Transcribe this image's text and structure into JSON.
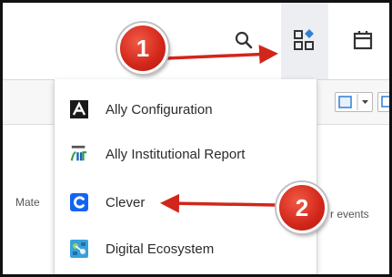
{
  "toolbar": {
    "icons": [
      "search-icon",
      "apps-grid-icon",
      "calendar-icon"
    ]
  },
  "background": {
    "left_text": "Mate",
    "right_text": "r events"
  },
  "app_menu": {
    "items": [
      {
        "label": "Ally Configuration",
        "icon": "ally-logo-icon"
      },
      {
        "label": "Ally Institutional Report",
        "icon": "ally-report-logo-icon"
      },
      {
        "label": "Clever",
        "icon": "clever-logo-icon"
      },
      {
        "label": "Digital Ecosystem",
        "icon": "digital-ecosystem-icon"
      }
    ]
  },
  "annotations": {
    "step1": "1",
    "step2": "2",
    "color": "#d2261a"
  },
  "colors": {
    "accent_blue": "#2f7fd6",
    "clever_blue": "#1464f4",
    "highlight": "#eceef1"
  }
}
